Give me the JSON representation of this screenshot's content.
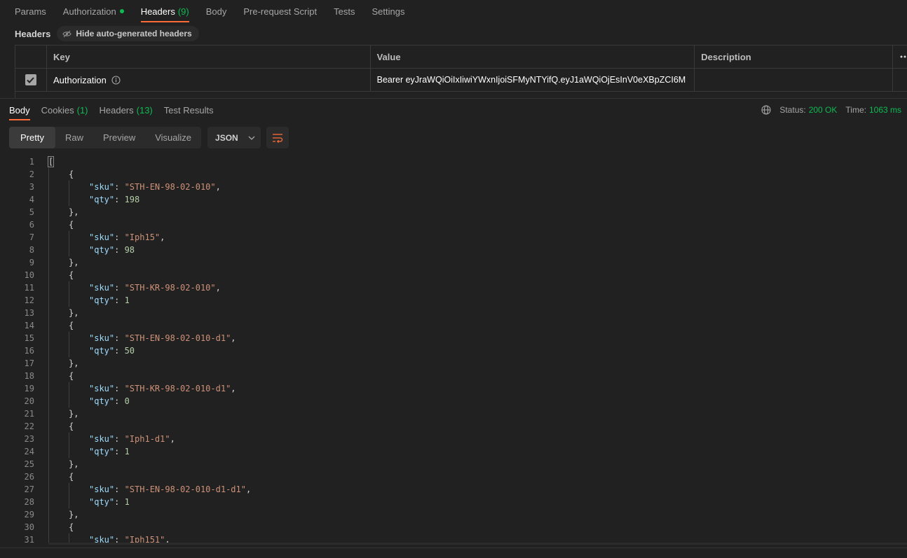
{
  "request_tabs": [
    {
      "label": "Params"
    },
    {
      "label": "Authorization"
    },
    {
      "label": "Headers",
      "count": "(9)"
    },
    {
      "label": "Body"
    },
    {
      "label": "Pre-request Script"
    },
    {
      "label": "Tests"
    },
    {
      "label": "Settings"
    }
  ],
  "headers_section": {
    "label": "Headers",
    "hide_auto_label": "Hide auto-generated headers"
  },
  "headers_table": {
    "columns": [
      "Key",
      "Value",
      "Description"
    ],
    "rows": [
      {
        "key": "Authorization",
        "value": "Bearer eyJraWQiOiIxIiwiYWxnIjoiSFMyNTYifQ.eyJ1aWQiOjEsInV0eXBpZCI6M",
        "description": ""
      }
    ]
  },
  "response_tabs": [
    {
      "label": "Body"
    },
    {
      "label": "Cookies",
      "count": "(1)"
    },
    {
      "label": "Headers",
      "count": "(13)"
    },
    {
      "label": "Test Results"
    }
  ],
  "status": {
    "status_label": "Status:",
    "status_value": "200 OK",
    "time_label": "Time:",
    "time_value": "1063 ms"
  },
  "view_modes": [
    "Pretty",
    "Raw",
    "Preview",
    "Visualize"
  ],
  "format": "JSON",
  "json_lines": [
    {
      "n": "1",
      "ind": 0,
      "t": [
        [
          "p",
          "["
        ]
      ]
    },
    {
      "n": "2",
      "ind": 1,
      "t": [
        [
          "p",
          "{"
        ]
      ]
    },
    {
      "n": "3",
      "ind": 2,
      "t": [
        [
          "k",
          "\"sku\""
        ],
        [
          "p",
          ": "
        ],
        [
          "s",
          "\"STH-EN-98-02-010\""
        ],
        [
          "p",
          ","
        ]
      ]
    },
    {
      "n": "4",
      "ind": 2,
      "t": [
        [
          "k",
          "\"qty\""
        ],
        [
          "p",
          ": "
        ],
        [
          "n",
          "198"
        ]
      ]
    },
    {
      "n": "5",
      "ind": 1,
      "t": [
        [
          "p",
          "},"
        ]
      ]
    },
    {
      "n": "6",
      "ind": 1,
      "t": [
        [
          "p",
          "{"
        ]
      ]
    },
    {
      "n": "7",
      "ind": 2,
      "t": [
        [
          "k",
          "\"sku\""
        ],
        [
          "p",
          ": "
        ],
        [
          "s",
          "\"Iph15\""
        ],
        [
          "p",
          ","
        ]
      ]
    },
    {
      "n": "8",
      "ind": 2,
      "t": [
        [
          "k",
          "\"qty\""
        ],
        [
          "p",
          ": "
        ],
        [
          "n",
          "98"
        ]
      ]
    },
    {
      "n": "9",
      "ind": 1,
      "t": [
        [
          "p",
          "},"
        ]
      ]
    },
    {
      "n": "10",
      "ind": 1,
      "t": [
        [
          "p",
          "{"
        ]
      ]
    },
    {
      "n": "11",
      "ind": 2,
      "t": [
        [
          "k",
          "\"sku\""
        ],
        [
          "p",
          ": "
        ],
        [
          "s",
          "\"STH-KR-98-02-010\""
        ],
        [
          "p",
          ","
        ]
      ]
    },
    {
      "n": "12",
      "ind": 2,
      "t": [
        [
          "k",
          "\"qty\""
        ],
        [
          "p",
          ": "
        ],
        [
          "n",
          "1"
        ]
      ]
    },
    {
      "n": "13",
      "ind": 1,
      "t": [
        [
          "p",
          "},"
        ]
      ]
    },
    {
      "n": "14",
      "ind": 1,
      "t": [
        [
          "p",
          "{"
        ]
      ]
    },
    {
      "n": "15",
      "ind": 2,
      "t": [
        [
          "k",
          "\"sku\""
        ],
        [
          "p",
          ": "
        ],
        [
          "s",
          "\"STH-EN-98-02-010-d1\""
        ],
        [
          "p",
          ","
        ]
      ]
    },
    {
      "n": "16",
      "ind": 2,
      "t": [
        [
          "k",
          "\"qty\""
        ],
        [
          "p",
          ": "
        ],
        [
          "n",
          "50"
        ]
      ]
    },
    {
      "n": "17",
      "ind": 1,
      "t": [
        [
          "p",
          "},"
        ]
      ]
    },
    {
      "n": "18",
      "ind": 1,
      "t": [
        [
          "p",
          "{"
        ]
      ]
    },
    {
      "n": "19",
      "ind": 2,
      "t": [
        [
          "k",
          "\"sku\""
        ],
        [
          "p",
          ": "
        ],
        [
          "s",
          "\"STH-KR-98-02-010-d1\""
        ],
        [
          "p",
          ","
        ]
      ]
    },
    {
      "n": "20",
      "ind": 2,
      "t": [
        [
          "k",
          "\"qty\""
        ],
        [
          "p",
          ": "
        ],
        [
          "n",
          "0"
        ]
      ]
    },
    {
      "n": "21",
      "ind": 1,
      "t": [
        [
          "p",
          "},"
        ]
      ]
    },
    {
      "n": "22",
      "ind": 1,
      "t": [
        [
          "p",
          "{"
        ]
      ]
    },
    {
      "n": "23",
      "ind": 2,
      "t": [
        [
          "k",
          "\"sku\""
        ],
        [
          "p",
          ": "
        ],
        [
          "s",
          "\"Iph1-d1\""
        ],
        [
          "p",
          ","
        ]
      ]
    },
    {
      "n": "24",
      "ind": 2,
      "t": [
        [
          "k",
          "\"qty\""
        ],
        [
          "p",
          ": "
        ],
        [
          "n",
          "1"
        ]
      ]
    },
    {
      "n": "25",
      "ind": 1,
      "t": [
        [
          "p",
          "},"
        ]
      ]
    },
    {
      "n": "26",
      "ind": 1,
      "t": [
        [
          "p",
          "{"
        ]
      ]
    },
    {
      "n": "27",
      "ind": 2,
      "t": [
        [
          "k",
          "\"sku\""
        ],
        [
          "p",
          ": "
        ],
        [
          "s",
          "\"STH-EN-98-02-010-d1-d1\""
        ],
        [
          "p",
          ","
        ]
      ]
    },
    {
      "n": "28",
      "ind": 2,
      "t": [
        [
          "k",
          "\"qty\""
        ],
        [
          "p",
          ": "
        ],
        [
          "n",
          "1"
        ]
      ]
    },
    {
      "n": "29",
      "ind": 1,
      "t": [
        [
          "p",
          "},"
        ]
      ]
    },
    {
      "n": "30",
      "ind": 1,
      "t": [
        [
          "p",
          "{"
        ]
      ]
    },
    {
      "n": "31",
      "ind": 2,
      "t": [
        [
          "k",
          "\"sku\""
        ],
        [
          "p",
          ": "
        ],
        [
          "s",
          "\"Iph151\""
        ],
        [
          "p",
          ","
        ]
      ]
    }
  ],
  "colors": {
    "accent": "#ff6c37",
    "success": "#0cbb52",
    "background": "#212121",
    "json_key": "#9cdcfe",
    "json_string": "#ce9178",
    "json_number": "#b5cea8"
  },
  "icons": {
    "auth_status": "green-dot-icon",
    "hide_auto": "eye-off-icon",
    "info": "info-icon",
    "globe": "globe-icon",
    "format_dropdown": "chevron-down-icon",
    "wrap": "wrap-lines-icon",
    "checkbox": "checkbox-checked-icon",
    "more": "more-horizontal-icon"
  }
}
